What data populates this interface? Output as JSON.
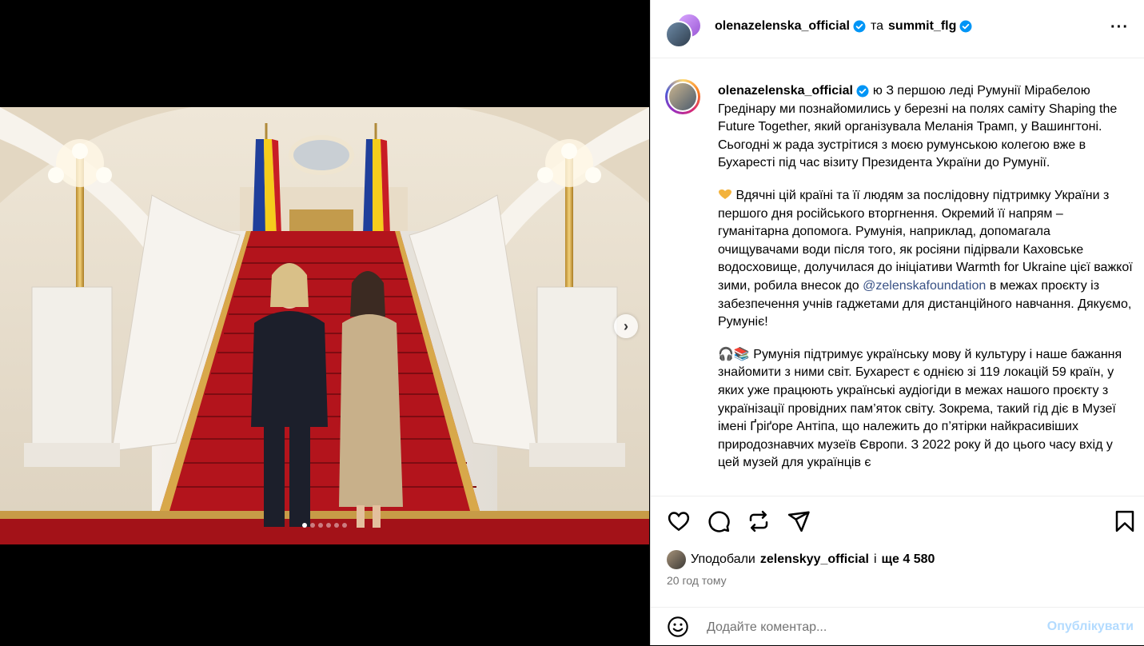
{
  "header": {
    "user1": "olenazelenska_official",
    "and": "та",
    "user2": "summit_flg",
    "more_icon": "more-horizontal-icon"
  },
  "caption": {
    "user": "olenazelenska_official",
    "p1": "ю З першою леді Румунії Мірабелою Гредінару ми познайомились у березні на полях саміту Shaping the Future Together, який організувала Меланія Трамп, у Вашингтоні. Сьогодні ж рада зустрітися з моєю румунською колегою вже в Бухаресті під час візиту Президента України до Румунії.",
    "p2_before": " Вдячні цій країні та її людям за послідовну підтримку України з першого дня російського вторгнення. Окремий її напрям – гуманітарна допомога. Румунія, наприклад, допомагала очищувачами води після того, як росіяни підірвали Каховське водосховище, долучилася до ініціативи Warmth for Ukraine цієї важкої зими, робила внесок до ",
    "p2_mention": "@zelenskafoundation",
    "p2_after": " в межах проєкту із забезпечення учнів гаджетами для дистанційного навчання. Дякуємо, Румуніє!",
    "p3": "🎧📚 Румунія підтримує українську мову й культуру і наше бажання знайомити з ними світ. Бухарест є однією зі 119 локацій 59 країн, у яких уже працюють українські аудіогіди в межах нашого проєкту з українізації провідних пам’яток світу. Зокрема, такий гід діє в Музеї імені Ґріґоре Антіпа, що належить до п’ятірки найкрасивіших природознавчих музеїв Європи. З 2022 року й до цього часу вхід у цей музей для українців є"
  },
  "likes": {
    "prefix": "Уподобали",
    "user": "zelenskyy_official",
    "middle": "і",
    "count": "ще 4 580"
  },
  "time": "20 год тому",
  "comment": {
    "placeholder": "Додайте коментар...",
    "publish": "Опублікувати"
  },
  "carousel": {
    "total": 6,
    "active": 1
  },
  "colors": {
    "verified": "#0095f6",
    "mention": "#385185",
    "publish_disabled": "#b3dbff",
    "carpet": "#b3141c"
  }
}
